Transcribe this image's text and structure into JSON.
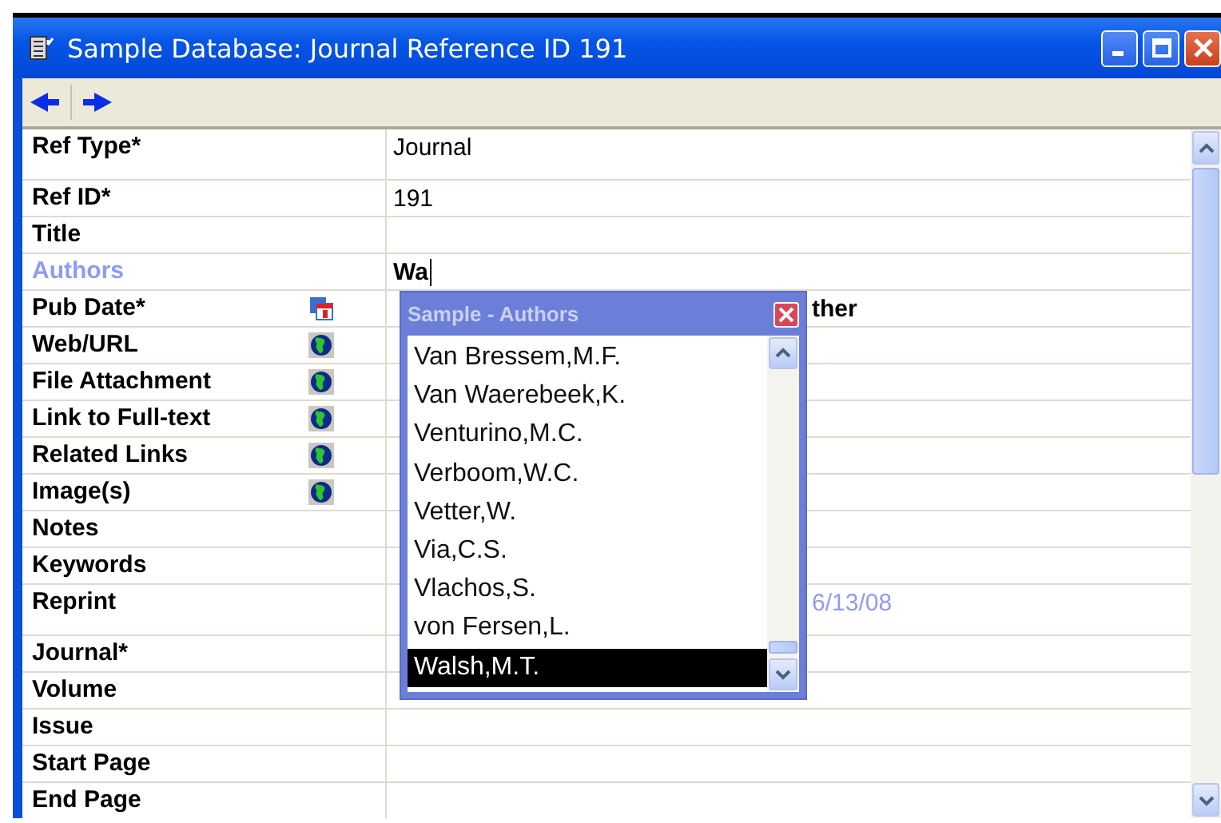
{
  "window": {
    "title": "Sample Database: Journal Reference ID 191"
  },
  "fields": [
    {
      "label": "Ref Type*",
      "value": "Journal",
      "kind": "memo",
      "active": false
    },
    {
      "label": "Ref ID*",
      "value": "191",
      "kind": "text",
      "active": false
    },
    {
      "label": "Title",
      "kind": "text",
      "active": false
    },
    {
      "label": "Authors",
      "value": "Wa",
      "kind": "text",
      "active": true
    },
    {
      "label": "Pub Date*",
      "kind": "date",
      "active": false,
      "extra": {
        "text": "ther",
        "kind": "bold"
      }
    },
    {
      "label": "Web/URL",
      "kind": "link",
      "active": false
    },
    {
      "label": "File Attachment",
      "kind": "link",
      "active": false
    },
    {
      "label": "Link to Full-text",
      "kind": "link",
      "active": false
    },
    {
      "label": "Related Links",
      "kind": "link",
      "active": false
    },
    {
      "label": "Image(s)",
      "kind": "link",
      "active": false
    },
    {
      "label": "Notes",
      "kind": "text",
      "active": false
    },
    {
      "label": "Keywords",
      "kind": "text",
      "active": false
    },
    {
      "label": "Reprint",
      "kind": "memo",
      "active": false,
      "extra": {
        "text": "6/13/08",
        "kind": "date"
      }
    },
    {
      "label": "Journal*",
      "kind": "text",
      "active": false
    },
    {
      "label": "Volume",
      "kind": "text",
      "active": false
    },
    {
      "label": "Issue",
      "kind": "text",
      "active": false
    },
    {
      "label": "Start Page",
      "kind": "text",
      "active": false
    },
    {
      "label": "End Page",
      "kind": "text",
      "active": false
    }
  ],
  "popup": {
    "title": "Sample - Authors",
    "items": [
      {
        "text": "Van Bressem,M.F.",
        "selected": false
      },
      {
        "text": "Van Waerebeek,K.",
        "selected": false
      },
      {
        "text": "Venturino,M.C.",
        "selected": false
      },
      {
        "text": "Verboom,W.C.",
        "selected": false
      },
      {
        "text": "Vetter,W.",
        "selected": false
      },
      {
        "text": "Via,C.S.",
        "selected": false
      },
      {
        "text": "Vlachos,S.",
        "selected": false
      },
      {
        "text": "von Fersen,L.",
        "selected": false
      },
      {
        "text": "Walsh,M.T.",
        "selected": true
      }
    ]
  }
}
